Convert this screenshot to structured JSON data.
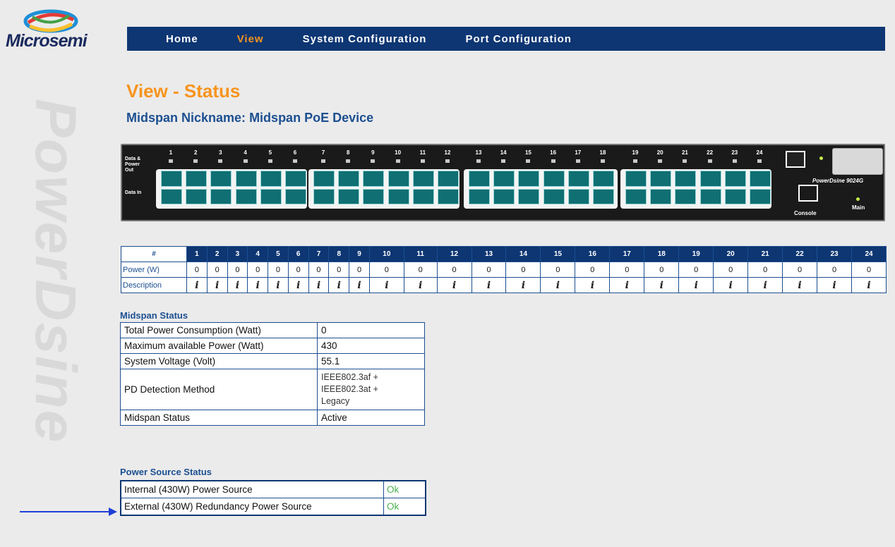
{
  "brand": {
    "logo_text": "Microsemi",
    "watermark": "PowerDsine"
  },
  "nav": {
    "items": [
      "Home",
      "View",
      "System Configuration",
      "Port Configuration"
    ],
    "active": "View"
  },
  "page": {
    "title": "View - Status",
    "nickname_label": "Midspan Nickname:",
    "nickname_value": "Midspan PoE Device"
  },
  "device_panel": {
    "left_labels": [
      "Data &",
      "Power",
      "Out",
      "Data In"
    ],
    "port_numbers": [
      "1",
      "2",
      "3",
      "4",
      "5",
      "6",
      "7",
      "8",
      "9",
      "10",
      "11",
      "12",
      "13",
      "14",
      "15",
      "16",
      "17",
      "18",
      "19",
      "20",
      "21",
      "22",
      "23",
      "24"
    ],
    "console_label": "Console",
    "main_label": "Main",
    "model_label": "PowerDsine 9024G"
  },
  "port_table": {
    "header_label": "#",
    "power_label": "Power (W)",
    "description_label": "Description",
    "ports": [
      "1",
      "2",
      "3",
      "4",
      "5",
      "6",
      "7",
      "8",
      "9",
      "10",
      "11",
      "12",
      "13",
      "14",
      "15",
      "16",
      "17",
      "18",
      "19",
      "20",
      "21",
      "22",
      "23",
      "24"
    ],
    "power_values": [
      "0",
      "0",
      "0",
      "0",
      "0",
      "0",
      "0",
      "0",
      "0",
      "0",
      "0",
      "0",
      "0",
      "0",
      "0",
      "0",
      "0",
      "0",
      "0",
      "0",
      "0",
      "0",
      "0",
      "0"
    ],
    "description_icon": "i"
  },
  "midspan_status": {
    "title": "Midspan Status",
    "rows": [
      {
        "label": "Total Power Consumption (Watt)",
        "value": "0"
      },
      {
        "label": "Maximum available Power (Watt)",
        "value": "430"
      },
      {
        "label": "System Voltage (Volt)",
        "value": "55.1"
      },
      {
        "label": "PD Detection Method",
        "value_lines": [
          "IEEE802.3af +",
          "IEEE802.3at +",
          "Legacy"
        ]
      },
      {
        "label": "Midspan Status",
        "value": "Active"
      }
    ]
  },
  "power_source_status": {
    "title": "Power Source Status",
    "rows": [
      {
        "label": "Internal (430W) Power Source",
        "value": "Ok"
      },
      {
        "label": "External (430W) Redundancy Power Source",
        "value": "Ok"
      }
    ]
  },
  "colors": {
    "nav_bg": "#0d3673",
    "accent_orange": "#f7941d",
    "title_blue": "#1c4f91",
    "ok_green": "#4caf50"
  }
}
